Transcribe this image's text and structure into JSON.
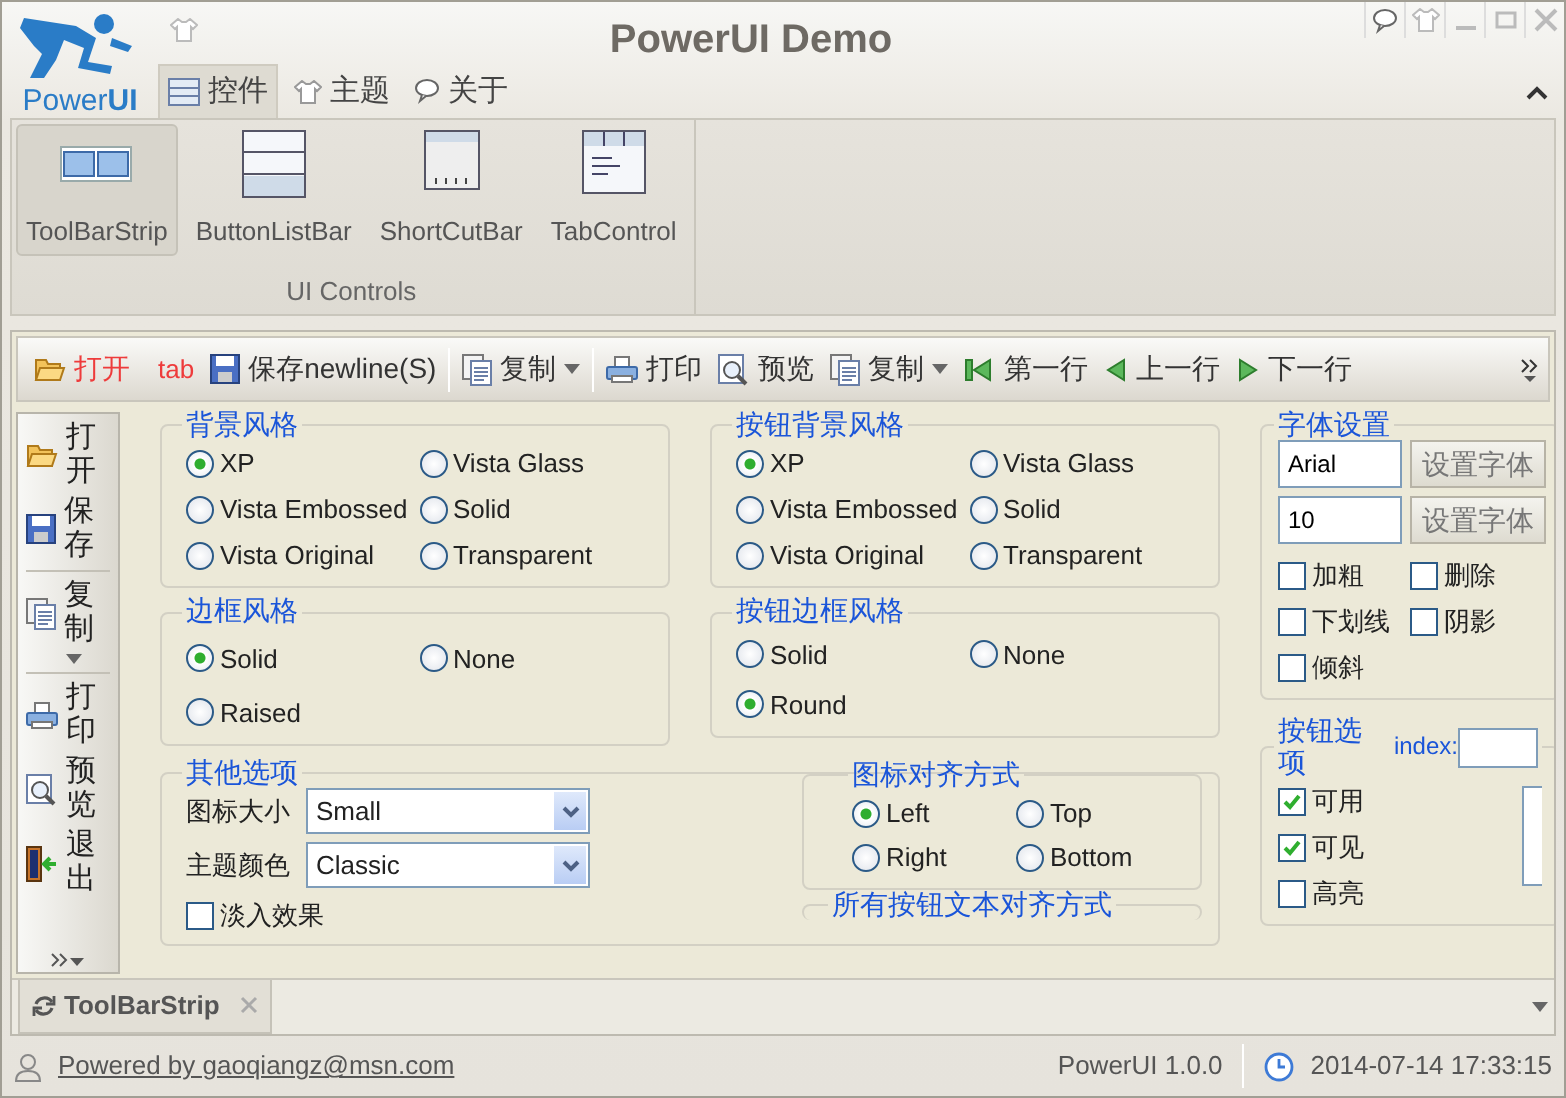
{
  "window": {
    "title": "PowerUI Demo",
    "logo": "Power**UI**"
  },
  "ribbon": {
    "tabs": [
      {
        "label": "控件",
        "selected": true
      },
      {
        "label": "主题",
        "selected": false
      },
      {
        "label": "关于",
        "selected": false
      }
    ],
    "groups": [
      {
        "label": "UI Controls",
        "buttons": [
          {
            "label": "ToolBarStrip",
            "selected": true
          },
          {
            "label": "ButtonListBar",
            "selected": false
          },
          {
            "label": "ShortCutBar",
            "selected": false
          },
          {
            "label": "TabControl",
            "selected": false
          }
        ]
      }
    ]
  },
  "toolbar": {
    "items": [
      {
        "kind": "button",
        "label": "打开",
        "color": "#ee3b3b"
      },
      {
        "kind": "text",
        "label": "tab",
        "color": "#ee3b3b"
      },
      {
        "kind": "button",
        "label": "保存newline(S)",
        "color": "#333333"
      },
      {
        "kind": "separator"
      },
      {
        "kind": "dropdown",
        "label": "复制",
        "color": "#333333"
      },
      {
        "kind": "separator"
      },
      {
        "kind": "button",
        "label": "打印",
        "color": "#333333"
      },
      {
        "kind": "button",
        "label": "预览",
        "color": "#333333"
      },
      {
        "kind": "dropdown",
        "label": "复制",
        "color": "#333333"
      },
      {
        "kind": "button",
        "label": "第一行",
        "color": "#333333"
      },
      {
        "kind": "button",
        "label": "上一行",
        "color": "#333333"
      },
      {
        "kind": "button",
        "label": "下一行",
        "color": "#333333"
      }
    ]
  },
  "side_toolbar": {
    "items": [
      {
        "kind": "button",
        "label": "打开"
      },
      {
        "kind": "button",
        "label": "保存"
      },
      {
        "kind": "separator"
      },
      {
        "kind": "dropdown",
        "label": "复制"
      },
      {
        "kind": "separator"
      },
      {
        "kind": "button",
        "label": "打印"
      },
      {
        "kind": "button",
        "label": "预览"
      },
      {
        "kind": "button",
        "label": "退出"
      }
    ]
  },
  "background_style": {
    "title": "背景风格",
    "options": [
      {
        "label": "XP",
        "selected": true
      },
      {
        "label": "Vista Glass",
        "selected": false
      },
      {
        "label": "Vista Embossed",
        "selected": false
      },
      {
        "label": "Solid",
        "selected": false
      },
      {
        "label": "Vista Original",
        "selected": false
      },
      {
        "label": "Transparent",
        "selected": false
      }
    ]
  },
  "button_background_style": {
    "title": "按钮背景风格",
    "options": [
      {
        "label": "XP",
        "selected": true
      },
      {
        "label": "Vista Glass",
        "selected": false
      },
      {
        "label": "Vista Embossed",
        "selected": false
      },
      {
        "label": "Solid",
        "selected": false
      },
      {
        "label": "Vista Original",
        "selected": false
      },
      {
        "label": "Transparent",
        "selected": false
      }
    ]
  },
  "font_settings": {
    "title": "字体设置",
    "fields": [
      {
        "value": "Arial",
        "button": "设置字体"
      },
      {
        "value": "10",
        "button": "设置字体"
      }
    ],
    "checkboxes": [
      {
        "label": "加粗",
        "checked": false
      },
      {
        "label": "删除",
        "checked": false
      },
      {
        "label": "下划线",
        "checked": false
      },
      {
        "label": "阴影",
        "checked": false
      },
      {
        "label": "倾斜",
        "checked": false
      }
    ]
  },
  "border_style": {
    "title": "边框风格",
    "options": [
      {
        "label": "Solid",
        "selected": true
      },
      {
        "label": "None",
        "selected": false
      },
      {
        "label": "Raised",
        "selected": false
      }
    ]
  },
  "button_border_style": {
    "title": "按钮边框风格",
    "options": [
      {
        "label": "Solid",
        "selected": false
      },
      {
        "label": "None",
        "selected": false
      },
      {
        "label": "Round",
        "selected": true
      }
    ]
  },
  "other_options": {
    "title": "其他选项",
    "fields": [
      {
        "label": "图标大小",
        "value": "Small"
      },
      {
        "label": "主题颜色",
        "value": "Classic"
      }
    ],
    "checkboxes": [
      {
        "label": "淡入效果",
        "checked": false
      }
    ],
    "icon_align": {
      "title": "图标对齐方式",
      "options": [
        {
          "label": "Left",
          "selected": true
        },
        {
          "label": "Top",
          "selected": false
        },
        {
          "label": "Right",
          "selected": false
        },
        {
          "label": "Bottom",
          "selected": false
        }
      ]
    },
    "text_align": {
      "title": "所有按钮文本对齐方式"
    }
  },
  "button_options": {
    "title": "按钮选项",
    "index_label": "index:",
    "checkboxes": [
      {
        "label": "可用",
        "checked": true
      },
      {
        "label": "可见",
        "checked": true
      },
      {
        "label": "高亮",
        "checked": false
      }
    ]
  },
  "doc_tabs": [
    {
      "label": "ToolBarStrip",
      "selected": true
    }
  ],
  "status_bar": {
    "link": "Powered by gaoqiangz@msn.com",
    "version": "PowerUI 1.0.0",
    "datetime": "2014-07-14 17:33:15"
  }
}
